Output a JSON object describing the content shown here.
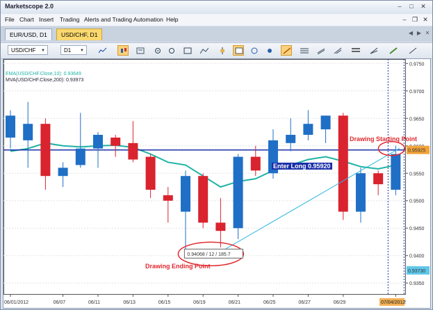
{
  "app": {
    "title": "Marketscope 2.0"
  },
  "menu": [
    "File",
    "Chart",
    "Insert",
    "Trading",
    "Alerts and Trading Automation",
    "Help"
  ],
  "tabs": [
    {
      "label": "EUR/USD, D1",
      "active": false
    },
    {
      "label": "USD/CHF, D1",
      "active": true
    }
  ],
  "toolbar": {
    "symbol": "USD/CHF",
    "timeframe": "D1"
  },
  "indicators": {
    "ema": "EMA(USD/CHF.Close,10): 0.93649",
    "mva": "MVA(USD/CHF.Close,200): 0.93973"
  },
  "annotations": {
    "enter_long": "Enter Long 0.95920",
    "drawing_start": "Drawing Starting Point",
    "drawing_end": "Drawing Ending Point",
    "measure": "0.94068 / 12 / 185.7"
  },
  "price_markers": {
    "current": "0.95925",
    "lower": "0.93730"
  },
  "colors": {
    "bull": "#1f6fc6",
    "bear": "#d9232e",
    "ema": "#1fb3a5",
    "horizontal": "#1a2fa8",
    "annotation_red": "#e0292f",
    "current_marker": "#f2a43a",
    "lower_marker": "#5fc7ea"
  },
  "chart_data": {
    "type": "candlestick",
    "ylim": [
      0.933,
      0.9758
    ],
    "y_ticks": [
      "0.9750",
      "0.9700",
      "0.9650",
      "0.9600",
      "0.9550",
      "0.9500",
      "0.9450",
      "0.9400",
      "0.9350"
    ],
    "x_labels": [
      "06/01/2012",
      "06/07",
      "06/11",
      "06/13",
      "06/15",
      "06/19",
      "06/21",
      "06/25",
      "06/27",
      "06/29",
      "07/04/2012"
    ],
    "candles": [
      {
        "o": 0.9615,
        "h": 0.9665,
        "l": 0.9595,
        "c": 0.9655
      },
      {
        "o": 0.961,
        "h": 0.968,
        "l": 0.956,
        "c": 0.964
      },
      {
        "o": 0.964,
        "h": 0.965,
        "l": 0.952,
        "c": 0.9545
      },
      {
        "o": 0.9545,
        "h": 0.957,
        "l": 0.9525,
        "c": 0.956
      },
      {
        "o": 0.9565,
        "h": 0.966,
        "l": 0.956,
        "c": 0.9595
      },
      {
        "o": 0.9595,
        "h": 0.9625,
        "l": 0.956,
        "c": 0.962
      },
      {
        "o": 0.9615,
        "h": 0.962,
        "l": 0.958,
        "c": 0.96
      },
      {
        "o": 0.9605,
        "h": 0.9645,
        "l": 0.957,
        "c": 0.9575
      },
      {
        "o": 0.958,
        "h": 0.9585,
        "l": 0.9505,
        "c": 0.952
      },
      {
        "o": 0.951,
        "h": 0.9525,
        "l": 0.946,
        "c": 0.95
      },
      {
        "o": 0.948,
        "h": 0.9555,
        "l": 0.941,
        "c": 0.9545
      },
      {
        "o": 0.9545,
        "h": 0.955,
        "l": 0.945,
        "c": 0.946
      },
      {
        "o": 0.946,
        "h": 0.9505,
        "l": 0.9415,
        "c": 0.9445
      },
      {
        "o": 0.945,
        "h": 0.9585,
        "l": 0.943,
        "c": 0.958
      },
      {
        "o": 0.958,
        "h": 0.96,
        "l": 0.9545,
        "c": 0.9555
      },
      {
        "o": 0.955,
        "h": 0.963,
        "l": 0.954,
        "c": 0.961
      },
      {
        "o": 0.9605,
        "h": 0.965,
        "l": 0.959,
        "c": 0.962
      },
      {
        "o": 0.962,
        "h": 0.9665,
        "l": 0.961,
        "c": 0.964
      },
      {
        "o": 0.963,
        "h": 0.9655,
        "l": 0.9605,
        "c": 0.9655
      },
      {
        "o": 0.9655,
        "h": 0.966,
        "l": 0.9465,
        "c": 0.948
      },
      {
        "o": 0.948,
        "h": 0.956,
        "l": 0.946,
        "c": 0.955
      },
      {
        "o": 0.955,
        "h": 0.9555,
        "l": 0.951,
        "c": 0.953
      },
      {
        "o": 0.952,
        "h": 0.96,
        "l": 0.951,
        "c": 0.9585
      }
    ],
    "ema_series": [
      0.959,
      0.9595,
      0.9605,
      0.96,
      0.9598,
      0.96,
      0.9601,
      0.9597,
      0.9585,
      0.957,
      0.9565,
      0.9545,
      0.9525,
      0.9535,
      0.954,
      0.9555,
      0.9565,
      0.9575,
      0.958,
      0.9572,
      0.9562,
      0.9558,
      0.9565
    ],
    "horizontal_level": 0.95925,
    "trendline": {
      "from": {
        "candle": 12,
        "price": 0.94068
      },
      "to": {
        "candle": 22,
        "price": 0.9596
      }
    }
  }
}
